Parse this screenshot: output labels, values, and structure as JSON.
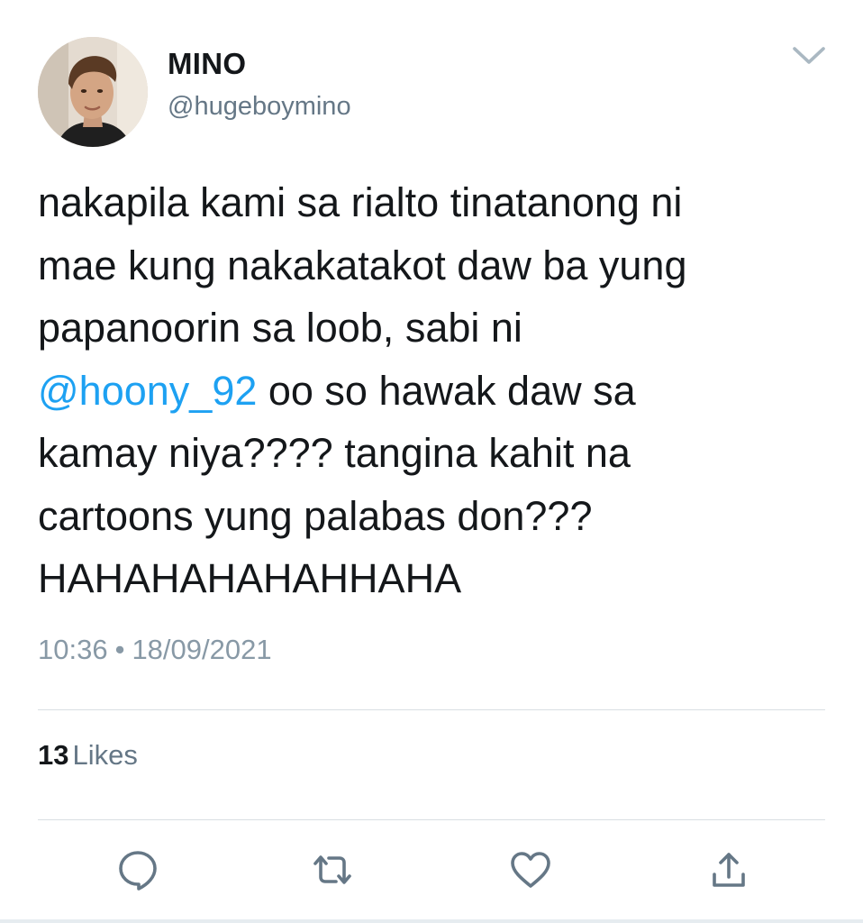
{
  "author": {
    "display_name": "MINO",
    "handle": "@hugeboymino",
    "avatar_icon": "profile-photo"
  },
  "tweet": {
    "lines": [
      {
        "text": "nakapila kami sa rialto tinatanong ni"
      },
      {
        "text": "mae kung nakakatakot daw ba yung"
      },
      {
        "text": "papanoorin sa loob, sabi ni"
      },
      {
        "mention": "@hoony_92",
        "text": " oo so hawak daw sa"
      },
      {
        "text": "kamay niya???? tangina kahit na"
      },
      {
        "text": "cartoons yung palabas don???"
      },
      {
        "text": "HAHAHAHAHAHHAHA"
      }
    ]
  },
  "meta": {
    "time": "10:36",
    "separator": "•",
    "date": "18/09/2021"
  },
  "stats": {
    "likes_count": "13",
    "likes_label": "Likes"
  },
  "actions": [
    {
      "icon": "reply-icon"
    },
    {
      "icon": "retweet-icon"
    },
    {
      "icon": "like-icon"
    },
    {
      "icon": "share-icon"
    }
  ],
  "colors": {
    "mention": "#1da1f2",
    "secondary_text": "#657786",
    "meta_text": "#8899a6",
    "icon": "#657786",
    "divider": "#d9dfe3"
  }
}
